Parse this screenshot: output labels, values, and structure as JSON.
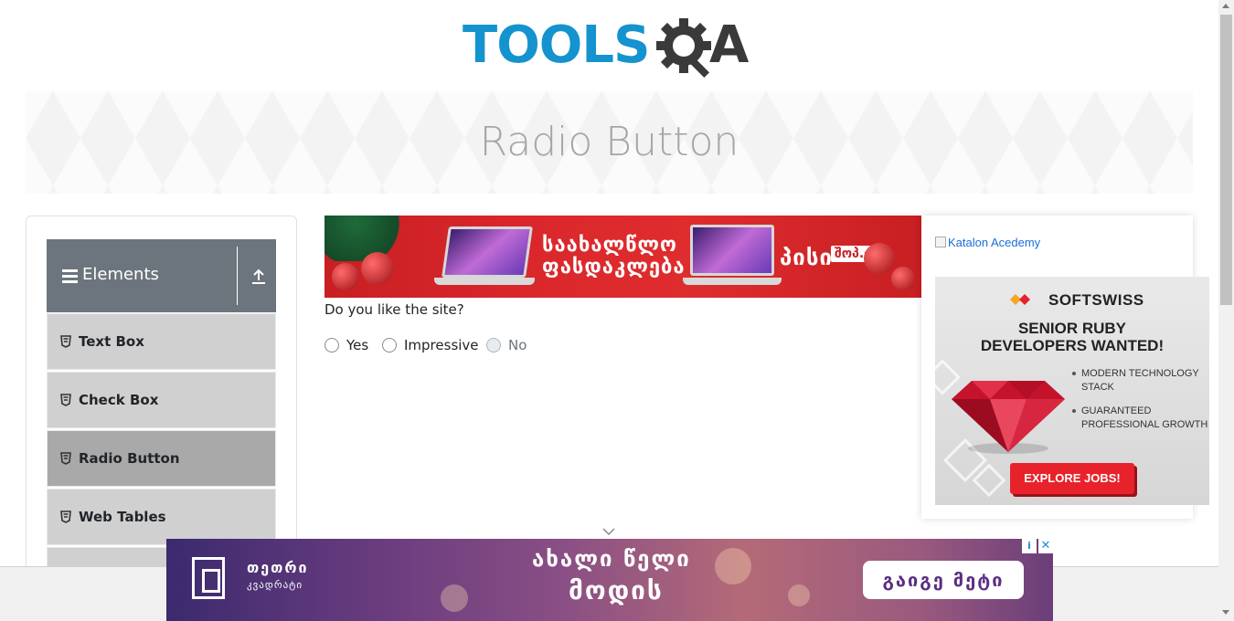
{
  "logo": {
    "tools_text": "TOOLS",
    "a_text": "A"
  },
  "header": {
    "title": "Radio Button"
  },
  "sidebar": {
    "group_title": "Elements",
    "items": [
      {
        "label": "Text Box"
      },
      {
        "label": "Check Box"
      },
      {
        "label": "Radio Button"
      },
      {
        "label": "Web Tables"
      }
    ]
  },
  "top_ad": {
    "text_line1": "საახალწლო",
    "text_line2": "ფასდაკლება",
    "brand": "პისი",
    "badge": "შოპ.ჯი"
  },
  "main": {
    "question": "Do you like the site?",
    "options": [
      {
        "label": "Yes",
        "disabled": false
      },
      {
        "label": "Impressive",
        "disabled": false
      },
      {
        "label": "No",
        "disabled": true
      }
    ]
  },
  "right_ads": {
    "katalon_alt": "Katalon Acedemy",
    "softswiss": {
      "brand": "SOFTSWISS",
      "headline1": "SENIOR RUBY",
      "headline2": "DEVELOPERS WANTED!",
      "bullet1": "MODERN TECHNOLOGY STACK",
      "bullet2": "GUARANTEED PROFESSIONAL GROWTH",
      "cta": "EXPLORE JOBS!"
    }
  },
  "bottom_ad": {
    "brand1": "თეთრი",
    "brand2": "კვადრატი",
    "headline1": "ახალი წელი",
    "headline2": "მოდის",
    "cta": "გაიგე მეტი",
    "adchoices": "i",
    "close": "✕"
  },
  "colors": {
    "tools_blue": "#1493cf",
    "nav_header": "#6c757d",
    "menu_item": "#d0d0d0",
    "menu_active": "#a9a9a9"
  }
}
